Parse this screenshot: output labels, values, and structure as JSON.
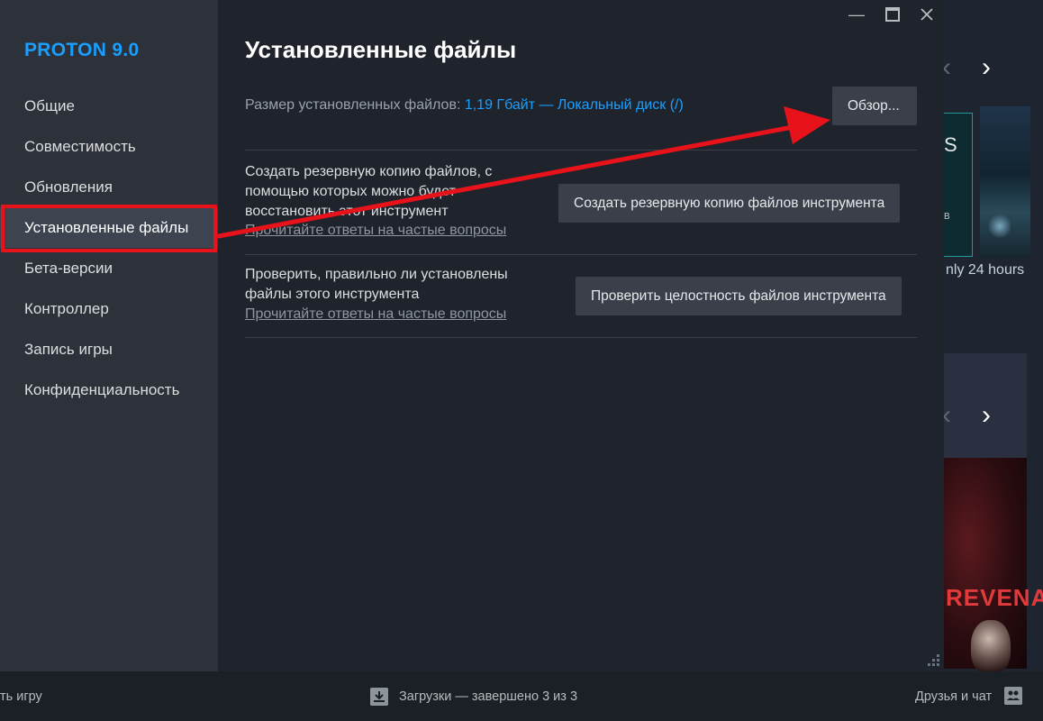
{
  "sidebar": {
    "title": "PROTON 9.0",
    "items": [
      {
        "label": "Общие"
      },
      {
        "label": "Совместимость"
      },
      {
        "label": "Обновления"
      },
      {
        "label": "Установленные файлы"
      },
      {
        "label": "Бета-версии"
      },
      {
        "label": "Контроллер"
      },
      {
        "label": "Запись игры"
      },
      {
        "label": "Конфиденциальность"
      }
    ],
    "active_index": 3
  },
  "window": {
    "minimize_icon": "minimize-icon",
    "maximize_icon": "maximize-icon",
    "close_icon": "close-icon"
  },
  "main": {
    "title": "Установленные файлы",
    "size_label": "Размер установленных файлов: ",
    "size_value": "1,19 Гбайт — Локальный диск (/)",
    "browse_button": "Обзор...",
    "backup": {
      "text_line1": "Создать резервную копию файлов, с",
      "text_line2": "помощью которых можно будет",
      "text_line3": "восстановить этот инструмент",
      "faq_link": "Прочитайте ответы на частые вопросы",
      "button": "Создать резервную копию файлов инструмента"
    },
    "verify": {
      "text_line1": "Проверить, правильно ли установлены",
      "text_line2": "файлы этого инструмента",
      "faq_link": "Прочитайте ответы на частые вопросы",
      "button": "Проверить целостность файлов инструмента"
    }
  },
  "background": {
    "card_label": "nly 24 hours",
    "card1_text": "S",
    "card3_text": "REVENA"
  },
  "bottom_bar": {
    "left_text": "ть игру",
    "downloads_text": "Загрузки — завершено 3 из 3",
    "friends_text": "Друзья и чат"
  },
  "colors": {
    "accent": "#1a9fff",
    "annotation": "#e8121a"
  }
}
